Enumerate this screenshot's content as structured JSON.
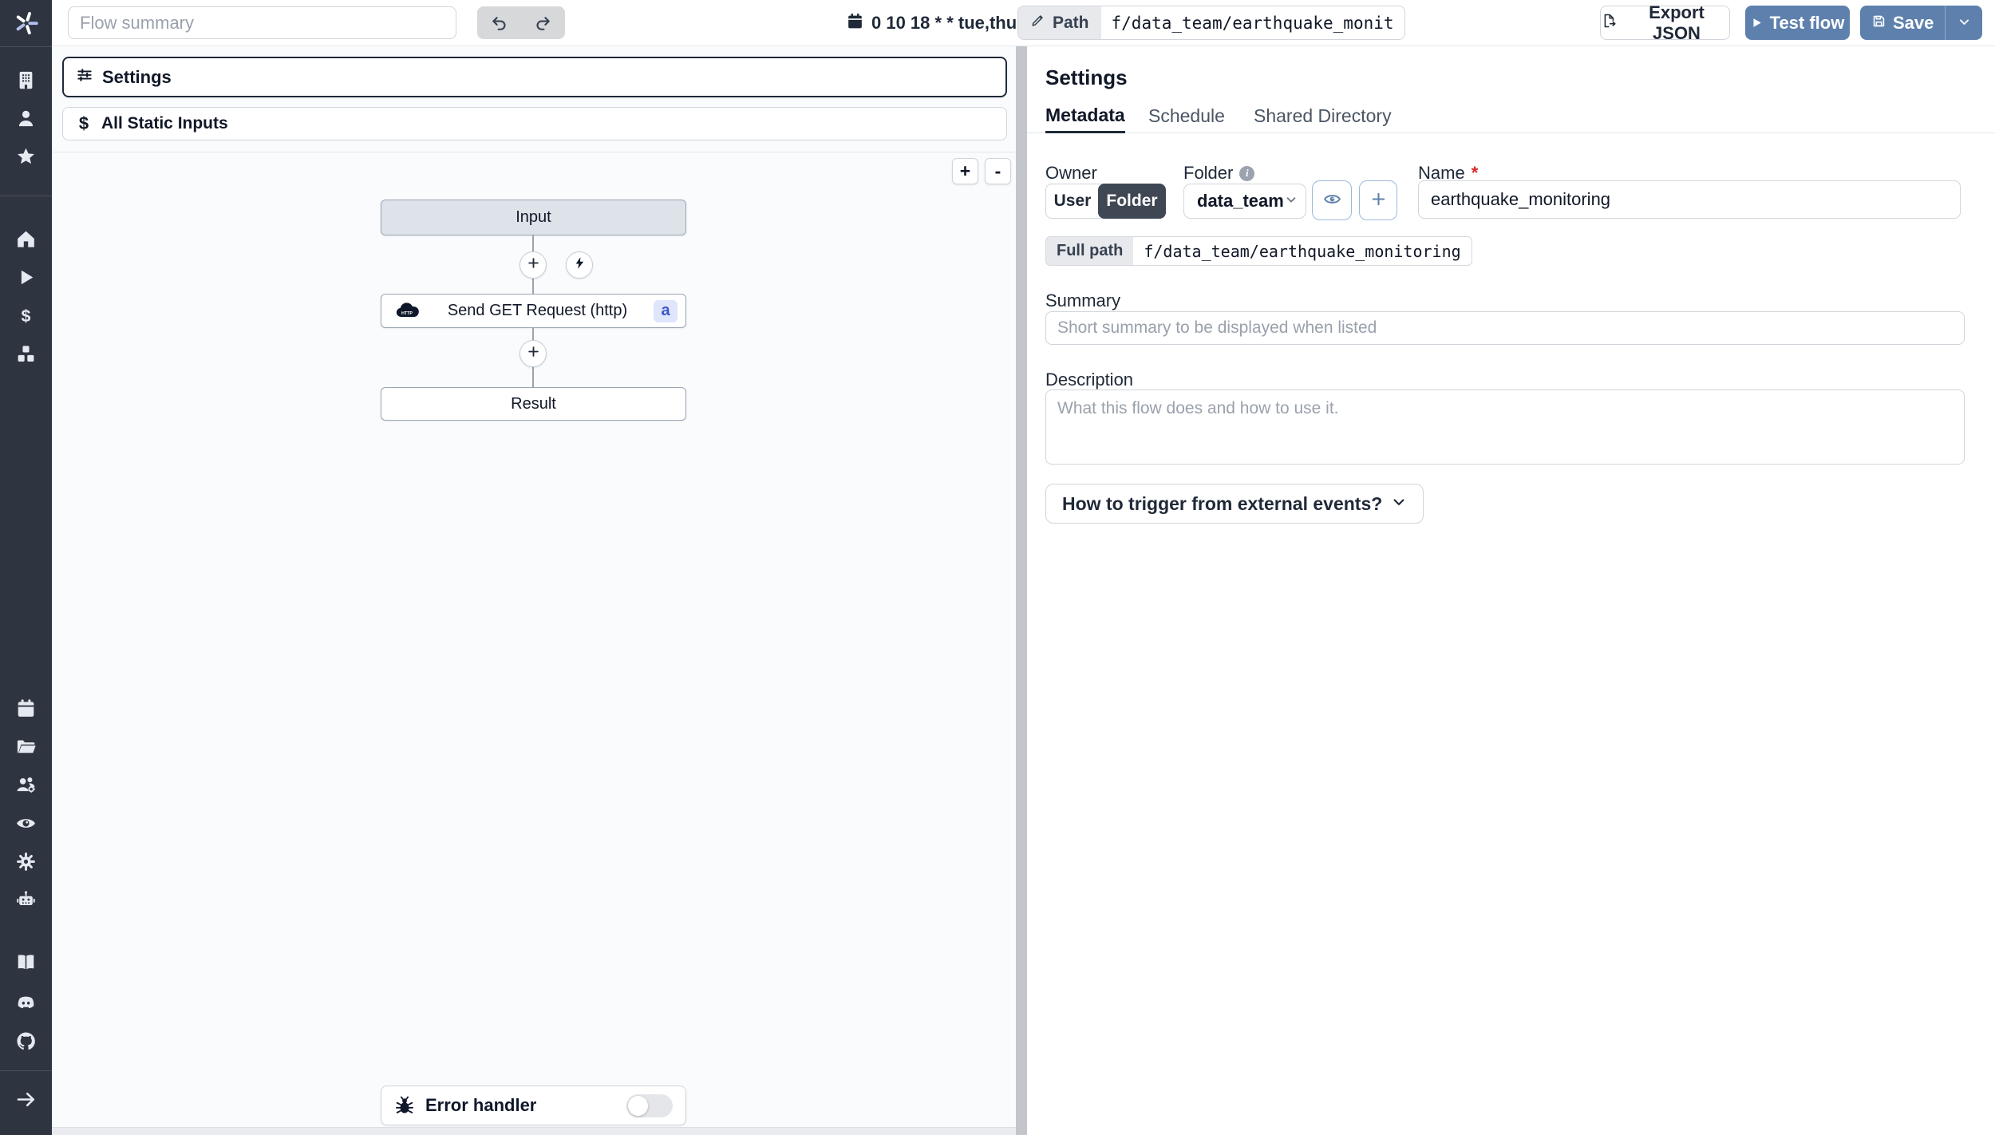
{
  "topbar": {
    "flow_summary_placeholder": "Flow summary",
    "cron_schedule": "0 10 18 * * tue,thu",
    "path_label": "Path",
    "path_value": "f/data_team/earthquake_monit",
    "export_json_label": "Export JSON",
    "test_flow_label": "Test flow",
    "save_label": "Save"
  },
  "sidebar": {
    "icons": [
      "windmill-logo",
      "building",
      "user",
      "star",
      "home",
      "runs-play",
      "variables-dollar",
      "resources-cubes",
      "schedules-calendar",
      "folders",
      "groups-gear",
      "audit-eye",
      "settings-gear",
      "workers-robot",
      "docs-book",
      "discord",
      "github",
      "expand-arrow"
    ]
  },
  "flow_panel": {
    "settings_item_label": "Settings",
    "static_inputs_label": "All Static Inputs",
    "zoom_in_label": "+",
    "zoom_out_label": "-",
    "nodes": {
      "input_label": "Input",
      "http_label": "Send GET Request (http)",
      "http_badge": "a",
      "http_icon_text": "HTTP",
      "result_label": "Result",
      "error_handler_label": "Error handler"
    }
  },
  "settings_panel": {
    "title": "Settings",
    "tabs": [
      "Metadata",
      "Schedule",
      "Shared Directory"
    ],
    "owner": {
      "label": "Owner",
      "user_option": "User",
      "folder_option": "Folder"
    },
    "folder": {
      "label": "Folder",
      "selected_value": "data_team"
    },
    "name": {
      "label": "Name",
      "required_mark": "*",
      "value": "earthquake_monitoring"
    },
    "full_path": {
      "label": "Full path",
      "value": "f/data_team/earthquake_monitoring"
    },
    "summary": {
      "label": "Summary",
      "placeholder": "Short summary to be displayed when listed"
    },
    "description": {
      "label": "Description",
      "placeholder": "What this flow does and how to use it."
    },
    "trigger_button_label": "How to trigger from external events?"
  },
  "colors": {
    "sidebar_bg": "#2e3440",
    "primary_button": "#5e80ad",
    "selected_border": "#1e293b",
    "badge_bg": "#dfe5fb",
    "badge_text": "#3d56c9",
    "required_mark": "#dc2626",
    "input_node_bg": "#dee3ea"
  }
}
